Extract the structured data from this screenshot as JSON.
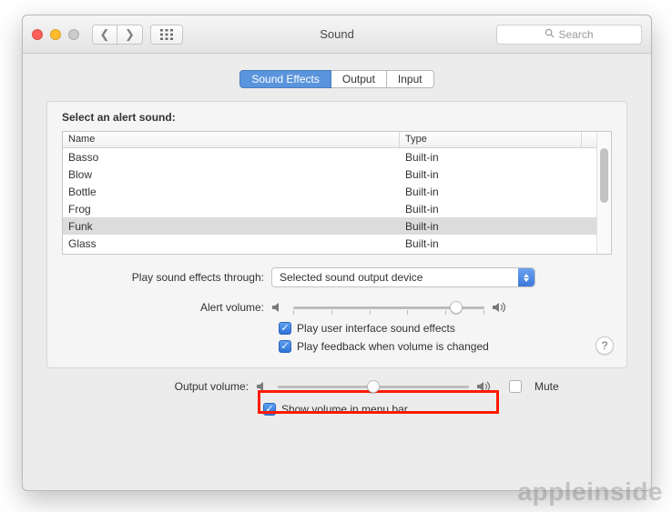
{
  "window": {
    "title": "Sound"
  },
  "toolbar": {
    "search_placeholder": "Search"
  },
  "tabs": {
    "items": [
      "Sound Effects",
      "Output",
      "Input"
    ],
    "active_index": 0
  },
  "panel": {
    "select_label": "Select an alert sound:",
    "columns": {
      "name": "Name",
      "type": "Type"
    },
    "sounds": [
      {
        "name": "Basso",
        "type": "Built-in",
        "selected": false
      },
      {
        "name": "Blow",
        "type": "Built-in",
        "selected": false
      },
      {
        "name": "Bottle",
        "type": "Built-in",
        "selected": false
      },
      {
        "name": "Frog",
        "type": "Built-in",
        "selected": false
      },
      {
        "name": "Funk",
        "type": "Built-in",
        "selected": true
      },
      {
        "name": "Glass",
        "type": "Built-in",
        "selected": false
      }
    ],
    "play_through_label": "Play sound effects through:",
    "play_through_value": "Selected sound output device",
    "alert_volume_label": "Alert volume:",
    "alert_volume_percent": 85,
    "check_ui_sounds": {
      "label": "Play user interface sound effects",
      "checked": true
    },
    "check_feedback": {
      "label": "Play feedback when volume is changed",
      "checked": true
    }
  },
  "output": {
    "volume_label": "Output volume:",
    "volume_percent": 50,
    "mute_label": "Mute",
    "mute_checked": false,
    "show_menu_label": "Show volume in menu bar",
    "show_menu_checked": true
  },
  "help_label": "?",
  "watermark": "appleinside"
}
